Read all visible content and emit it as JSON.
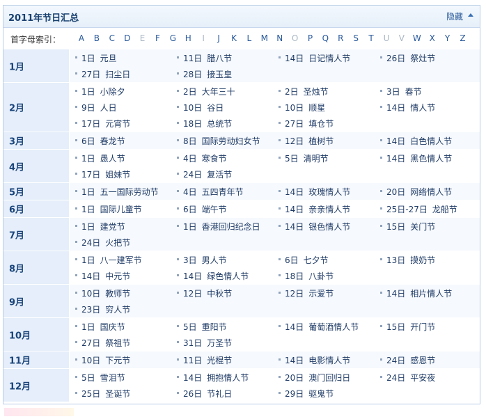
{
  "header": {
    "title": "2011年节日汇总",
    "toggle_label": "隐藏"
  },
  "alpha_index": {
    "label": "首字母索引：",
    "letters": [
      {
        "char": "A",
        "enabled": true
      },
      {
        "char": "B",
        "enabled": true
      },
      {
        "char": "C",
        "enabled": true
      },
      {
        "char": "D",
        "enabled": true
      },
      {
        "char": "E",
        "enabled": false
      },
      {
        "char": "F",
        "enabled": true
      },
      {
        "char": "G",
        "enabled": true
      },
      {
        "char": "H",
        "enabled": true
      },
      {
        "char": "I",
        "enabled": false
      },
      {
        "char": "J",
        "enabled": true
      },
      {
        "char": "K",
        "enabled": true
      },
      {
        "char": "L",
        "enabled": true
      },
      {
        "char": "M",
        "enabled": true
      },
      {
        "char": "N",
        "enabled": true
      },
      {
        "char": "O",
        "enabled": false
      },
      {
        "char": "P",
        "enabled": true
      },
      {
        "char": "Q",
        "enabled": true
      },
      {
        "char": "R",
        "enabled": true
      },
      {
        "char": "S",
        "enabled": true
      },
      {
        "char": "T",
        "enabled": true
      },
      {
        "char": "U",
        "enabled": false
      },
      {
        "char": "V",
        "enabled": false
      },
      {
        "char": "W",
        "enabled": true
      },
      {
        "char": "X",
        "enabled": true
      },
      {
        "char": "Y",
        "enabled": true
      },
      {
        "char": "Z",
        "enabled": true
      }
    ]
  },
  "months": [
    {
      "month": "1月",
      "festivals": [
        {
          "day": "1日",
          "name": "元旦"
        },
        {
          "day": "11日",
          "name": "腊八节"
        },
        {
          "day": "14日",
          "name": "日记情人节"
        },
        {
          "day": "26日",
          "name": "祭灶节"
        },
        {
          "day": "27日",
          "name": "扫尘日"
        },
        {
          "day": "28日",
          "name": "接玉皇"
        }
      ]
    },
    {
      "month": "2月",
      "festivals": [
        {
          "day": "1日",
          "name": "小除夕"
        },
        {
          "day": "2日",
          "name": "大年三十"
        },
        {
          "day": "2日",
          "name": "圣烛节"
        },
        {
          "day": "3日",
          "name": "春节"
        },
        {
          "day": "9日",
          "name": "人日"
        },
        {
          "day": "10日",
          "name": "谷日"
        },
        {
          "day": "10日",
          "name": "顺星"
        },
        {
          "day": "14日",
          "name": "情人节"
        },
        {
          "day": "17日",
          "name": "元宵节"
        },
        {
          "day": "18日",
          "name": "总统节"
        },
        {
          "day": "27日",
          "name": "填仓节"
        }
      ]
    },
    {
      "month": "3月",
      "festivals": [
        {
          "day": "6日",
          "name": "春龙节"
        },
        {
          "day": "8日",
          "name": "国际劳动妇女节"
        },
        {
          "day": "12日",
          "name": "植树节"
        },
        {
          "day": "14日",
          "name": "白色情人节"
        }
      ]
    },
    {
      "month": "4月",
      "festivals": [
        {
          "day": "1日",
          "name": "愚人节"
        },
        {
          "day": "4日",
          "name": "寒食节"
        },
        {
          "day": "5日",
          "name": "清明节"
        },
        {
          "day": "14日",
          "name": "黑色情人节"
        },
        {
          "day": "17日",
          "name": "姐妹节"
        },
        {
          "day": "24日",
          "name": "复活节"
        }
      ]
    },
    {
      "month": "5月",
      "festivals": [
        {
          "day": "1日",
          "name": "五一国际劳动节"
        },
        {
          "day": "4日",
          "name": "五四青年节"
        },
        {
          "day": "14日",
          "name": "玫瑰情人节"
        },
        {
          "day": "20日",
          "name": "网络情人节"
        }
      ]
    },
    {
      "month": "6月",
      "festivals": [
        {
          "day": "1日",
          "name": "国际儿童节"
        },
        {
          "day": "6日",
          "name": "端午节"
        },
        {
          "day": "14日",
          "name": "亲亲情人节"
        },
        {
          "day": "25日-27日",
          "name": "龙船节"
        }
      ]
    },
    {
      "month": "7月",
      "festivals": [
        {
          "day": "1日",
          "name": "建党节"
        },
        {
          "day": "1日",
          "name": "香港回归纪念日"
        },
        {
          "day": "14日",
          "name": "银色情人节"
        },
        {
          "day": "15日",
          "name": "关门节"
        },
        {
          "day": "24日",
          "name": "火把节"
        }
      ]
    },
    {
      "month": "8月",
      "festivals": [
        {
          "day": "1日",
          "name": "八一建军节"
        },
        {
          "day": "3日",
          "name": "男人节"
        },
        {
          "day": "6日",
          "name": "七夕节"
        },
        {
          "day": "13日",
          "name": "摸奶节"
        },
        {
          "day": "14日",
          "name": "中元节"
        },
        {
          "day": "14日",
          "name": "绿色情人节"
        },
        {
          "day": "18日",
          "name": "八卦节"
        }
      ]
    },
    {
      "month": "9月",
      "festivals": [
        {
          "day": "10日",
          "name": "教师节"
        },
        {
          "day": "12日",
          "name": "中秋节"
        },
        {
          "day": "12日",
          "name": "示爱节"
        },
        {
          "day": "14日",
          "name": "相片情人节"
        },
        {
          "day": "23日",
          "name": "穷人节"
        }
      ]
    },
    {
      "month": "10月",
      "festivals": [
        {
          "day": "1日",
          "name": "国庆节"
        },
        {
          "day": "5日",
          "name": "重阳节"
        },
        {
          "day": "14日",
          "name": "葡萄酒情人节"
        },
        {
          "day": "15日",
          "name": "开门节"
        },
        {
          "day": "27日",
          "name": "祭祖节"
        },
        {
          "day": "31日",
          "name": "万圣节"
        }
      ]
    },
    {
      "month": "11月",
      "festivals": [
        {
          "day": "10日",
          "name": "下元节"
        },
        {
          "day": "11日",
          "name": "光棍节"
        },
        {
          "day": "14日",
          "name": "电影情人节"
        },
        {
          "day": "24日",
          "name": "感恩节"
        }
      ]
    },
    {
      "month": "12月",
      "festivals": [
        {
          "day": "5日",
          "name": "雪泪节"
        },
        {
          "day": "14日",
          "name": "拥抱情人节"
        },
        {
          "day": "20日",
          "name": "澳门回归日"
        },
        {
          "day": "24日",
          "name": "平安夜"
        },
        {
          "day": "25日",
          "name": "圣诞节"
        },
        {
          "day": "26日",
          "name": "节礼日"
        },
        {
          "day": "29日",
          "name": "驱鬼节"
        }
      ]
    }
  ]
}
